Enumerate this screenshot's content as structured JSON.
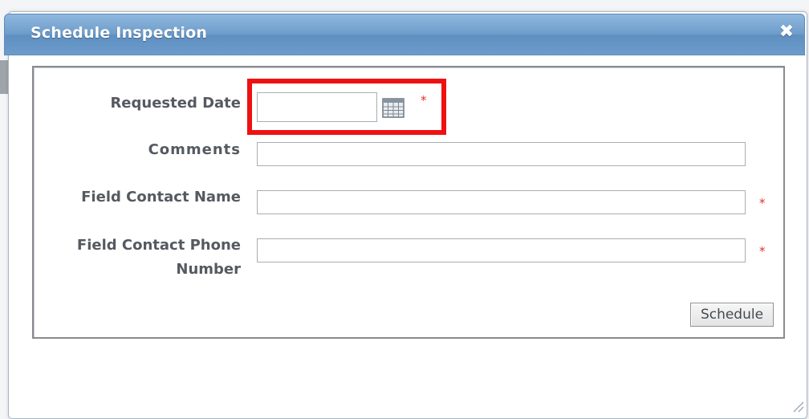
{
  "dialog": {
    "title": "Schedule Inspection",
    "close_symbol": "✖",
    "close_icon": "close-icon"
  },
  "form": {
    "requested_date": {
      "label": "Requested Date",
      "value": "",
      "required_mark": "*",
      "calendar_icon": "calendar-icon"
    },
    "comments": {
      "label": "Comments",
      "value": ""
    },
    "field_contact_name": {
      "label": "Field Contact Name",
      "value": "",
      "required_mark": "*"
    },
    "field_contact_phone": {
      "label_line1": "Field Contact Phone",
      "label_line2": "Number",
      "value": "",
      "required_mark": "*"
    },
    "schedule_button_label": "Schedule"
  },
  "colors": {
    "title_bar": "#6e9dcb",
    "highlight": "#ee1111",
    "required": "#e03030",
    "label_text": "#555a60"
  },
  "icons": {
    "resize_grip": "resize-grip-icon"
  }
}
